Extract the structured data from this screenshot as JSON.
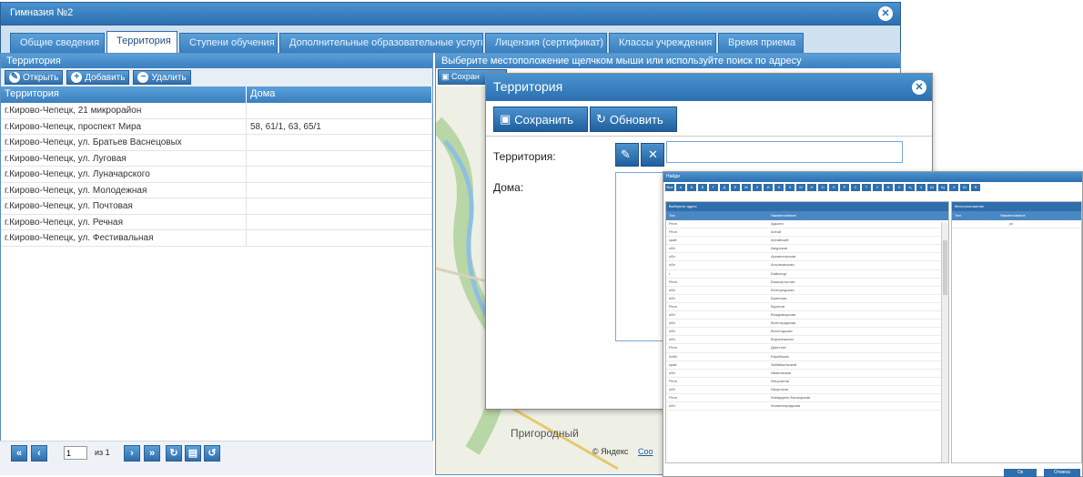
{
  "window": {
    "title": "Гимназия №2"
  },
  "tabs": [
    "Общие сведения",
    "Территория",
    "Ступени обучения",
    "Дополнительные образовательные услуги",
    "Лицензия (сертификат)",
    "Классы учреждения",
    "Время приема"
  ],
  "left": {
    "panel_title": "Территория",
    "toolbar": {
      "open": "Открыть",
      "add": "Добавить",
      "delete": "Удалить"
    },
    "columns": [
      "Территория",
      "Дома"
    ],
    "rows": [
      [
        "г.Кирово-Чепецк, 21 микрорайон",
        ""
      ],
      [
        "г.Кирово-Чепецк, проспект Мира",
        "58, 61/1, 63, 65/1"
      ],
      [
        "г.Кирово-Чепецк, ул. Братьев Васнецовых",
        ""
      ],
      [
        "г.Кирово-Чепецк, ул. Луговая",
        ""
      ],
      [
        "г.Кирово-Чепецк, ул. Луначарского",
        ""
      ],
      [
        "г.Кирово-Чепецк, ул. Молодежная",
        ""
      ],
      [
        "г.Кирово-Чепецк, ул. Почтовая",
        ""
      ],
      [
        "г.Кирово-Чепецк, ул. Речная",
        ""
      ],
      [
        "г.Кирово-Чепецк, ул. Фестивальная",
        ""
      ]
    ],
    "pager": {
      "page": "1",
      "of": "из 1"
    }
  },
  "right": {
    "hint": "Выберите местоположение щелчком мыши или используйте поиск по адресу",
    "save_partial": "Сохран",
    "map_label": "Пригородный",
    "yandex": "© Яндекс",
    "yandex_link": "Соо"
  },
  "dialog": {
    "title": "Территория",
    "save": "Сохранить",
    "refresh": "Обновить",
    "territory_label": "Территория:",
    "houses_label": "Дома:",
    "territory_value": ""
  },
  "selector": {
    "title": "Найди",
    "alphabet": [
      "Все",
      "А",
      "Б",
      "В",
      "Г",
      "Д",
      "Е",
      "Ж",
      "З",
      "И",
      "К",
      "Л",
      "М",
      "Н",
      "О",
      "П",
      "Р",
      "С",
      "Т",
      "У",
      "Ф",
      "Х",
      "Ц",
      "Ч",
      "Ш",
      "Щ",
      "Э",
      "Ю",
      "Я"
    ],
    "left_title": "Выберите адрес",
    "right_title": "Местоположение",
    "cols": [
      "Тип",
      "Наименование"
    ],
    "right_row": [
      "",
      "ул"
    ],
    "rows": [
      [
        "Респ",
        "Адыгея"
      ],
      [
        "Респ",
        "Алтай"
      ],
      [
        "край",
        "Алтайский"
      ],
      [
        "обл",
        "Амурская"
      ],
      [
        "обл",
        "Архангельская"
      ],
      [
        "обл",
        "Астраханская"
      ],
      [
        "г",
        "Байконур"
      ],
      [
        "Респ",
        "Башкортостан"
      ],
      [
        "обл",
        "Белгородская"
      ],
      [
        "обл",
        "Брянская"
      ],
      [
        "Респ",
        "Бурятия"
      ],
      [
        "обл",
        "Владимирская"
      ],
      [
        "обл",
        "Волгоградская"
      ],
      [
        "обл",
        "Вологодская"
      ],
      [
        "обл",
        "Воронежская"
      ],
      [
        "Респ",
        "Дагестан"
      ],
      [
        "Аобл",
        "Еврейская"
      ],
      [
        "край",
        "Забайкальский"
      ],
      [
        "обл",
        "Ивановская"
      ],
      [
        "Респ",
        "Ингушетия"
      ],
      [
        "обл",
        "Иркутская"
      ],
      [
        "Респ",
        "Кабардино-Балкарская"
      ],
      [
        "обл",
        "Калининградская"
      ]
    ],
    "ok": "Ок",
    "cancel": "Отмена"
  }
}
